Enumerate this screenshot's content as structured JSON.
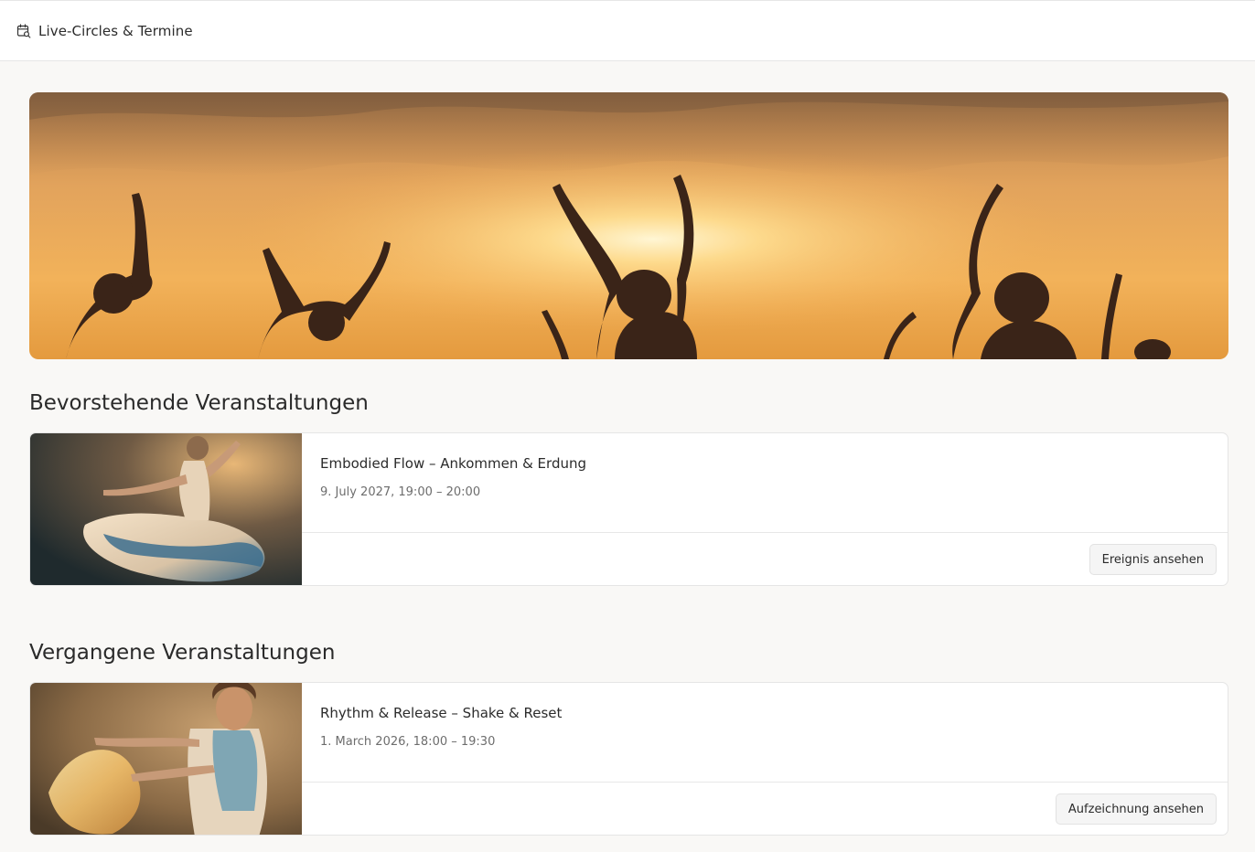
{
  "header": {
    "title": "Live-Circles & Termine",
    "icon": "calendar-search-icon"
  },
  "sections": {
    "upcoming_title": "Bevorstehende Veranstaltungen",
    "past_title": "Vergangene Veranstaltungen"
  },
  "upcoming": [
    {
      "title": "Embodied Flow – Ankommen & Erdung",
      "date": "9. July 2027, 19:00 – 20:00",
      "button": "Ereignis ansehen"
    }
  ],
  "past": [
    {
      "title": "Rhythm & Release – Shake & Reset",
      "date": "1. March 2026, 18:00 – 19:30",
      "button": "Aufzeichnung ansehen"
    }
  ],
  "colors": {
    "background": "#f9f8f6",
    "card": "#ffffff",
    "sunset_top": "#c98b4f",
    "sunset_glow": "#ffe7a8"
  }
}
